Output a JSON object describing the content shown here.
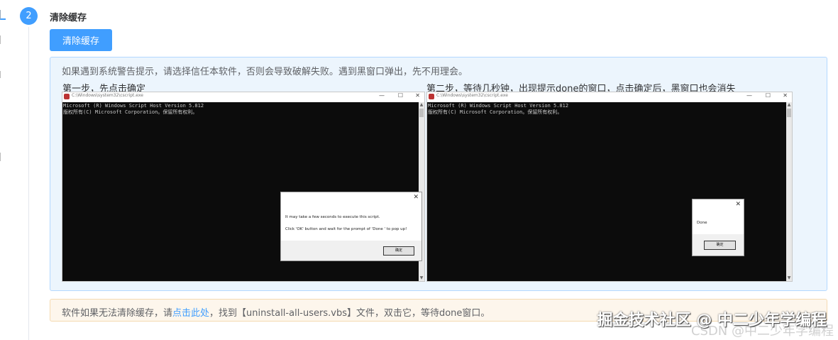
{
  "step": {
    "number": "2",
    "title": "清除缓存",
    "button_label": "清除缓存"
  },
  "info": {
    "text": "如果遇到系统警告提示，请选择信任本软件，否则会导致破解失败。遇到黑窗口弹出，先不用理会。",
    "step1_caption": "第一步，先点击确定",
    "step2_caption": "第二步，等待几秒钟，出现提示done的窗口，点击确定后，黑窗口也会消失"
  },
  "screenshots": [
    {
      "title": "C:\\Windows\\system32\\cscript.exe",
      "console_line1": "Microsoft (R) Windows Script Host Version 5.812",
      "console_line2": "版权所有(C) Microsoft Corporation。保留所有权利。",
      "dialog_line1": "It may take a few seconds to execute this script.",
      "dialog_line2": "Click 'OK' button and wait for the prompt of 'Done ' to pop up!",
      "dialog_button": "确定"
    },
    {
      "title": "C:\\Windows\\system32\\cscript.exe",
      "console_line1": "Microsoft (R) Windows Script Host Version 5.812",
      "console_line2": "版权所有(C) Microsoft Corporation。保留所有权利。",
      "dialog_line1": "Done",
      "dialog_button": "确定"
    }
  ],
  "warning": {
    "prefix": "软件如果无法清除缓存，请",
    "link": "点击此处",
    "suffix": "，找到【uninstall-all-users.vbs】文件，双击它，等待done窗口。"
  },
  "watermark": {
    "main": "掘金技术社区 @ 中二少年学编程",
    "faint": "CSDN @中二少年学编程"
  },
  "icons": {
    "minimize": "—",
    "maximize": "☐",
    "close": "✕",
    "scroll_up": "▲",
    "scroll_down": "▼"
  },
  "colors": {
    "primary": "#409eff",
    "info_bg": "#ecf5fd",
    "warning_bg": "#fdf6ec"
  }
}
